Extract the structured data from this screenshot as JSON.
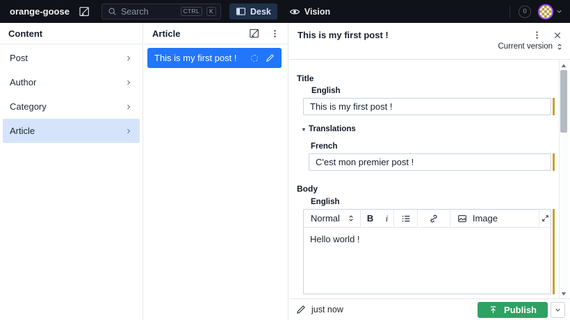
{
  "colors": {
    "topbar_bg": "#10121a",
    "active_tab_bg": "#203049",
    "selection_blue": "#2276fc",
    "sidebar_selected_bg": "#d5e4fb",
    "changed_bar_gold": "#c7a227",
    "publish_green": "#2fa162",
    "pane_border": "#e3e7ec"
  },
  "topbar": {
    "workspace": "orange-goose",
    "search": {
      "placeholder": "Search",
      "shortcut": [
        "CTRL",
        "K"
      ]
    },
    "tabs": [
      {
        "label": "Desk"
      },
      {
        "label": "Vision"
      }
    ],
    "badge_count": "0"
  },
  "sidebar": {
    "title": "Content",
    "items": [
      {
        "label": "Post"
      },
      {
        "label": "Author"
      },
      {
        "label": "Category"
      },
      {
        "label": "Article"
      }
    ]
  },
  "list_pane": {
    "title": "Article",
    "items": [
      {
        "label": "This is my first post !"
      }
    ]
  },
  "doc": {
    "title": "This is my first post !",
    "version": "Current version",
    "title_field": {
      "label": "Title",
      "lang": "English",
      "value": "This is my first post !"
    },
    "translations": {
      "label": "Translations",
      "lang": "French",
      "value": "C'est mon premier post !"
    },
    "body_field": {
      "label": "Body",
      "lang": "English"
    },
    "editor": {
      "style": "Normal",
      "bold": "B",
      "italic": "i",
      "image": "Image",
      "content": "Hello world !"
    },
    "footer": {
      "edited": "just now",
      "publish": "Publish"
    }
  }
}
